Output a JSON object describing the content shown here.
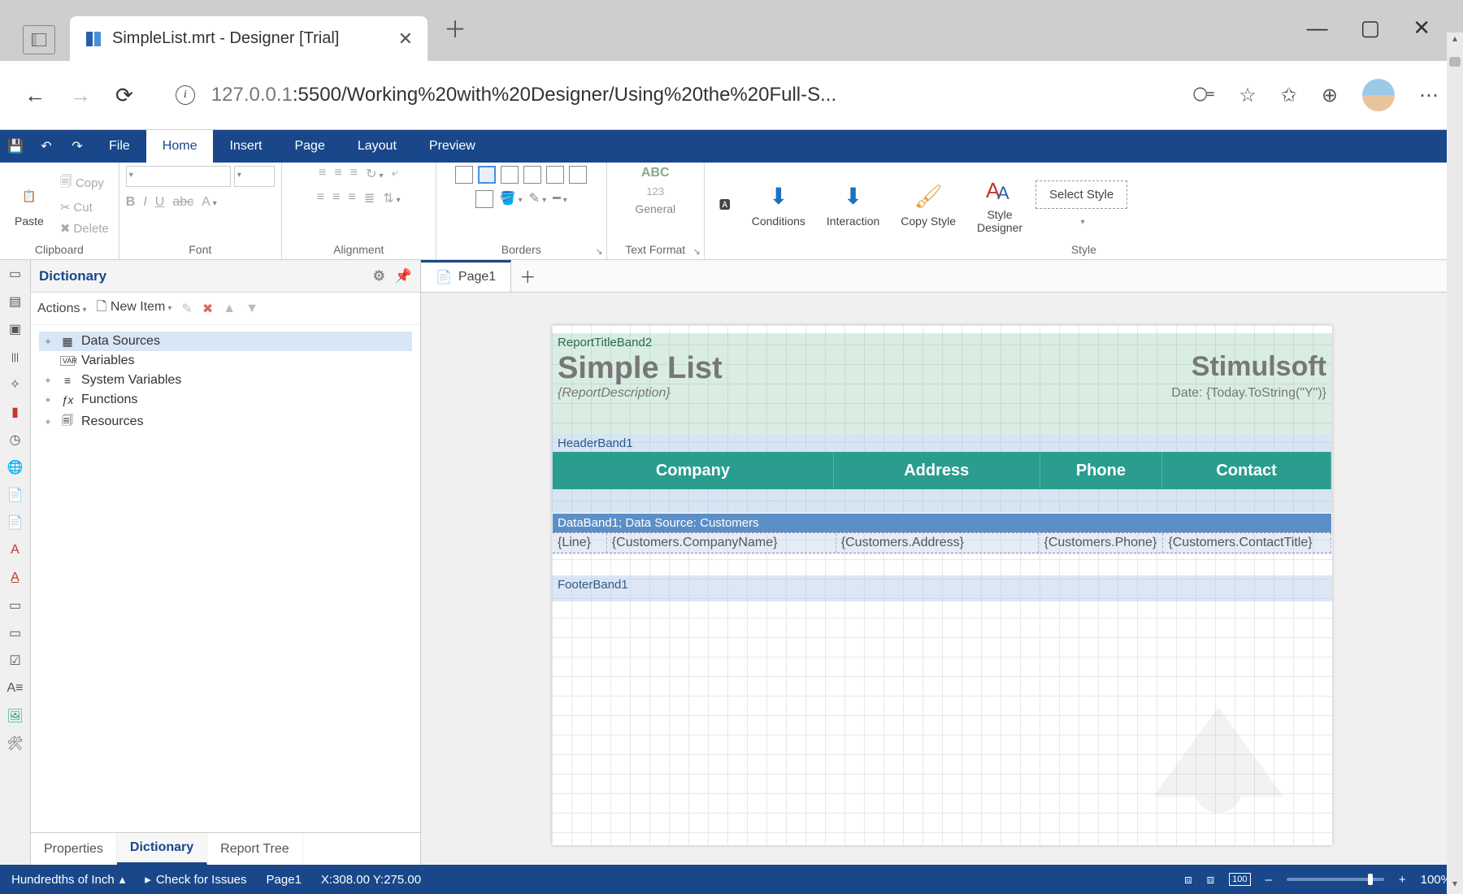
{
  "browser": {
    "tab_title": "SimpleList.mrt - Designer [Trial]",
    "url_host": "127.0.0.1",
    "url_rest": ":5500/Working%20with%20Designer/Using%20the%20Full-S..."
  },
  "menubar": {
    "items": [
      "File",
      "Home",
      "Insert",
      "Page",
      "Layout",
      "Preview"
    ],
    "active": "Home"
  },
  "ribbon": {
    "clipboard": {
      "paste": "Paste",
      "copy": "Copy",
      "cut": "Cut",
      "delete": "Delete",
      "label": "Clipboard"
    },
    "font": {
      "label": "Font"
    },
    "alignment": {
      "label": "Alignment"
    },
    "borders": {
      "label": "Borders"
    },
    "text_format": {
      "abc": "ABC",
      "num": "123",
      "general": "General",
      "label": "Text Format"
    },
    "style": {
      "conditions": "Conditions",
      "interaction": "Interaction",
      "copy_style": "Copy Style",
      "style_designer": "Style\nDesigner",
      "select_style": "Select Style",
      "label": "Style"
    }
  },
  "dictionary": {
    "title": "Dictionary",
    "actions": "Actions",
    "new_item": "New Item",
    "tree": [
      {
        "label": "Data Sources",
        "expandable": true,
        "selected": true,
        "icon": "▦"
      },
      {
        "label": "Variables",
        "expandable": false,
        "icon": "VAR"
      },
      {
        "label": "System Variables",
        "expandable": true,
        "icon": "≡"
      },
      {
        "label": "Functions",
        "expandable": true,
        "icon": "ƒx"
      },
      {
        "label": "Resources",
        "expandable": true,
        "icon": "🗐"
      }
    ],
    "tabs": [
      "Properties",
      "Dictionary",
      "Report Tree"
    ],
    "active_tab": "Dictionary"
  },
  "doc_tabs": {
    "page1": "Page1"
  },
  "report": {
    "rt_label": "ReportTitleBand2",
    "title": "Simple List",
    "brand": "Stimulsoft",
    "desc": "{ReportDescription}",
    "date": "Date: {Today.ToString(\"Y\")}",
    "hdr_label": "HeaderBand1",
    "columns": [
      "Company",
      "Address",
      "Phone",
      "Contact"
    ],
    "data_label": "DataBand1; Data Source: Customers",
    "cells": [
      "{Line}",
      "{Customers.CompanyName}",
      "{Customers.Address}",
      "{Customers.Phone}",
      "{Customers.ContactTitle}"
    ],
    "ftr_label": "FooterBand1"
  },
  "status": {
    "unit": "Hundredths of Inch",
    "check": "Check for Issues",
    "page": "Page1",
    "coords": "X:308.00 Y:275.00",
    "zoom": "100%"
  }
}
